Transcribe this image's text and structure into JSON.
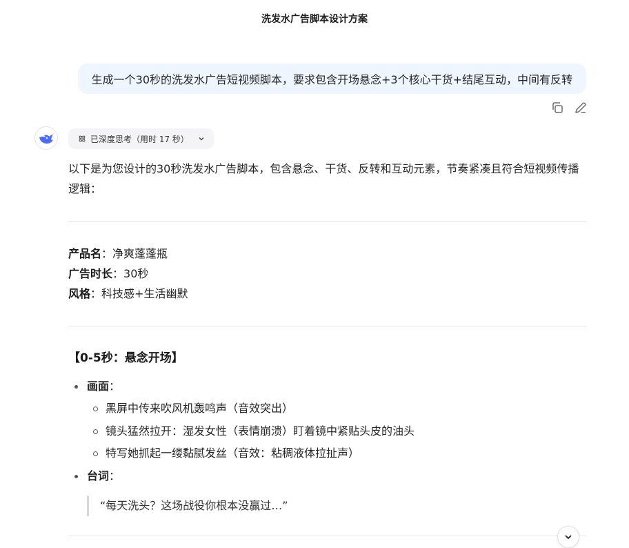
{
  "header": {
    "title": "洗发水广告脚本设计方案"
  },
  "user_message": {
    "text": "生成一个30秒的洗发水广告短视频脚本，要求包含开场悬念+3个核心干货+结尾互动，中间有反转"
  },
  "message_actions": {
    "icons": [
      "copy-icon",
      "edit-icon"
    ]
  },
  "assistant": {
    "avatar_icon": "whale-logo-icon",
    "thinking_label": "已深度思考（用时 17 秒）",
    "intro": "以下是为您设计的30秒洗发水广告脚本，包含悬念、干货、反转和互动元素，节奏紧凑且符合短视频传播逻辑：",
    "meta": [
      {
        "key": "产品名",
        "sep": "：",
        "value": "净爽蓬蓬瓶"
      },
      {
        "key": "广告时长",
        "sep": "：",
        "value": "30秒"
      },
      {
        "key": "风格",
        "sep": "：",
        "value": "科技感+生活幽默"
      }
    ],
    "section": {
      "heading": "【0-5秒：悬念开场】",
      "picture_label": "画面",
      "picture_sep": "：",
      "picture_items": [
        "黑屏中传来吹风机轰鸣声（音效突出）",
        "镜头猛然拉开：湿发女性（表情崩溃）盯着镜中紧贴头皮的油头",
        "特写她抓起一缕黏腻发丝（音效：粘稠液体拉扯声）"
      ],
      "line_label": "台词",
      "line_sep": "：",
      "quote": "“每天洗头？这场战役你根本没赢过…”"
    }
  },
  "colors": {
    "user_bubble": "#eff6ff",
    "accent": "#4d6bfe"
  }
}
